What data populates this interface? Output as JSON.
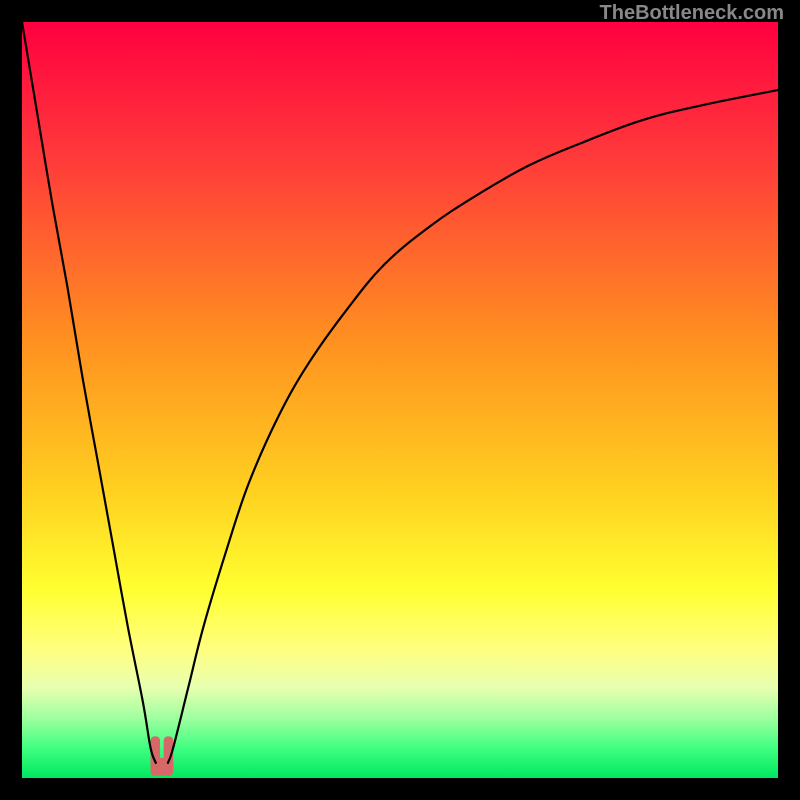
{
  "watermark": "TheBottleneck.com",
  "chart_data": {
    "type": "line",
    "xlim": [
      0,
      100
    ],
    "ylim": [
      0,
      100
    ],
    "grid": false,
    "legend": false,
    "title": "",
    "xlabel": "",
    "ylabel": "",
    "gradient_stops": [
      {
        "offset": 0,
        "color": "#ff0040"
      },
      {
        "offset": 18,
        "color": "#ff3a3a"
      },
      {
        "offset": 42,
        "color": "#ff9020"
      },
      {
        "offset": 62,
        "color": "#ffd020"
      },
      {
        "offset": 75,
        "color": "#ffff30"
      },
      {
        "offset": 83,
        "color": "#ffff80"
      },
      {
        "offset": 88,
        "color": "#e8ffb0"
      },
      {
        "offset": 92,
        "color": "#a0ffa0"
      },
      {
        "offset": 96,
        "color": "#40ff80"
      },
      {
        "offset": 100,
        "color": "#00e860"
      }
    ],
    "series": [
      {
        "name": "left-branch",
        "x": [
          0,
          2,
          4,
          6,
          8,
          10,
          12,
          14,
          16,
          17,
          17.7
        ],
        "values": [
          100,
          88,
          76,
          65,
          53,
          42,
          31,
          20,
          10,
          4,
          2
        ]
      },
      {
        "name": "right-branch",
        "x": [
          19.3,
          20,
          22,
          24,
          27,
          30,
          34,
          38,
          43,
          48,
          54,
          60,
          67,
          74,
          82,
          90,
          100
        ],
        "values": [
          2,
          4,
          12,
          20,
          30,
          39,
          48,
          55,
          62,
          68,
          73,
          77,
          81,
          84,
          87,
          89,
          91
        ]
      }
    ],
    "marker": {
      "x_center": 18.5,
      "y_value": 2,
      "color": "#d66868",
      "width_pct": 3.0
    }
  }
}
